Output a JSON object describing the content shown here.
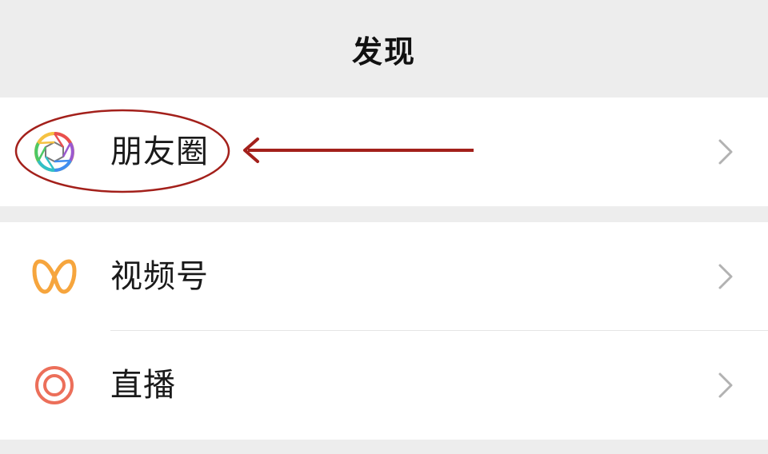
{
  "header": {
    "title": "发现"
  },
  "items": [
    {
      "label": "朋友圈",
      "icon": "moments-aperture-icon"
    },
    {
      "label": "视频号",
      "icon": "channels-butterfly-icon"
    },
    {
      "label": "直播",
      "icon": "live-target-icon"
    }
  ],
  "colors": {
    "background": "#ededed",
    "card": "#ffffff",
    "text": "#1a1a1a",
    "chevron": "#b2b2b2",
    "channels_icon": "#f6a53d",
    "live_icon": "#ec6f5a",
    "annotation": "#a3201b"
  },
  "annotation": {
    "type": "circle-and-arrow",
    "target": "朋友圈"
  }
}
